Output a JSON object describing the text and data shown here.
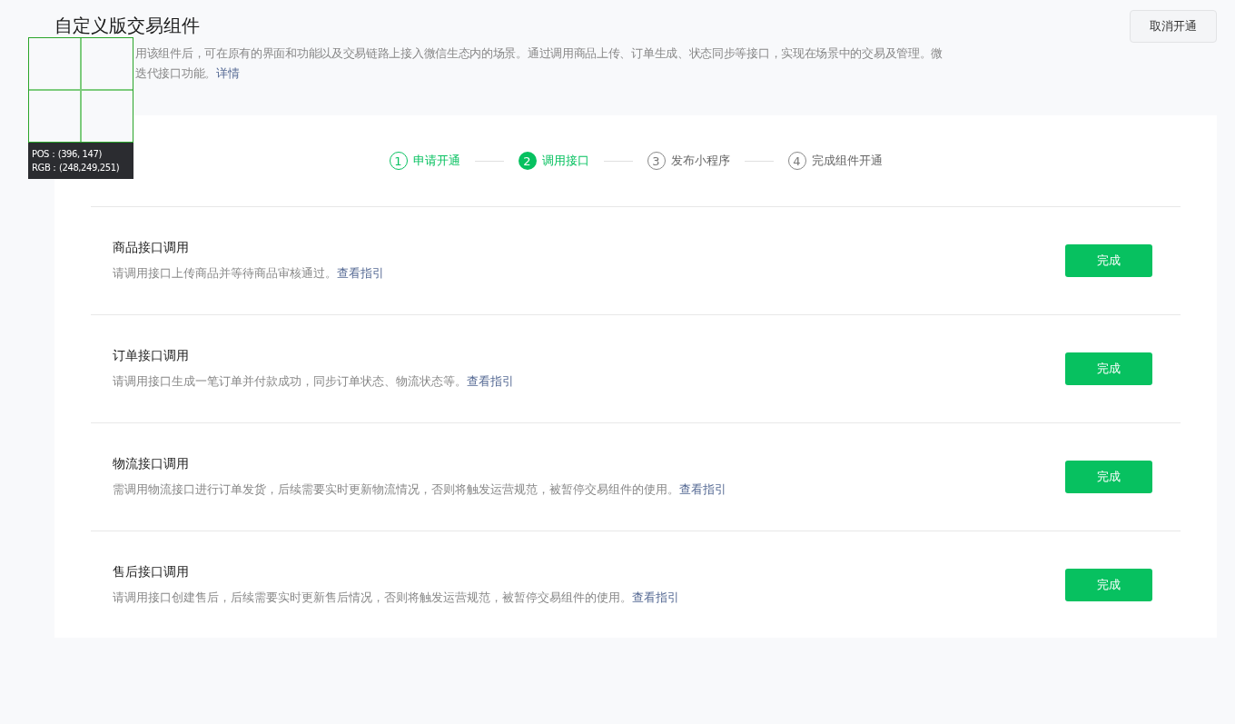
{
  "header": {
    "title": "自定义版交易组件",
    "description_lines": [
      "用该组件后，可在原有的界面和功能以及交易链路上接入微信生态内的场景。通过调用商品上传、订单生成、状态同步等接口，实现在场景中的交易及管理。微",
      "迭代接口功能。"
    ],
    "details_link": "详情",
    "cancel_button": "取消开通"
  },
  "steps": [
    {
      "number": "1",
      "label": "申请开通",
      "completed": true,
      "selected": false
    },
    {
      "number": "2",
      "label": "调用接口",
      "completed": false,
      "selected": true
    },
    {
      "number": "3",
      "label": "发布小程序",
      "completed": false,
      "selected": false
    },
    {
      "number": "4",
      "label": "完成组件开通",
      "completed": false,
      "selected": false
    }
  ],
  "tasks": [
    {
      "title": "商品接口调用",
      "description": "请调用接口上传商品并等待商品审核通过。",
      "link": "查看指引",
      "button": "完成"
    },
    {
      "title": "订单接口调用",
      "description": "请调用接口生成一笔订单并付款成功，同步订单状态、物流状态等。",
      "link": "查看指引",
      "button": "完成"
    },
    {
      "title": "物流接口调用",
      "description": "需调用物流接口进行订单发货，后续需要实时更新物流情况，否则将触发运营规范，被暂停交易组件的使用。",
      "link": "查看指引",
      "button": "完成"
    },
    {
      "title": "售后接口调用",
      "description": "请调用接口创建售后，后续需要实时更新售后情况，否则将触发运营规范，被暂停交易组件的使用。",
      "link": "查看指引",
      "button": "完成"
    }
  ],
  "picker": {
    "pos": "POS：(396, 147)",
    "rgb": "RGB：(248,249,251)"
  }
}
